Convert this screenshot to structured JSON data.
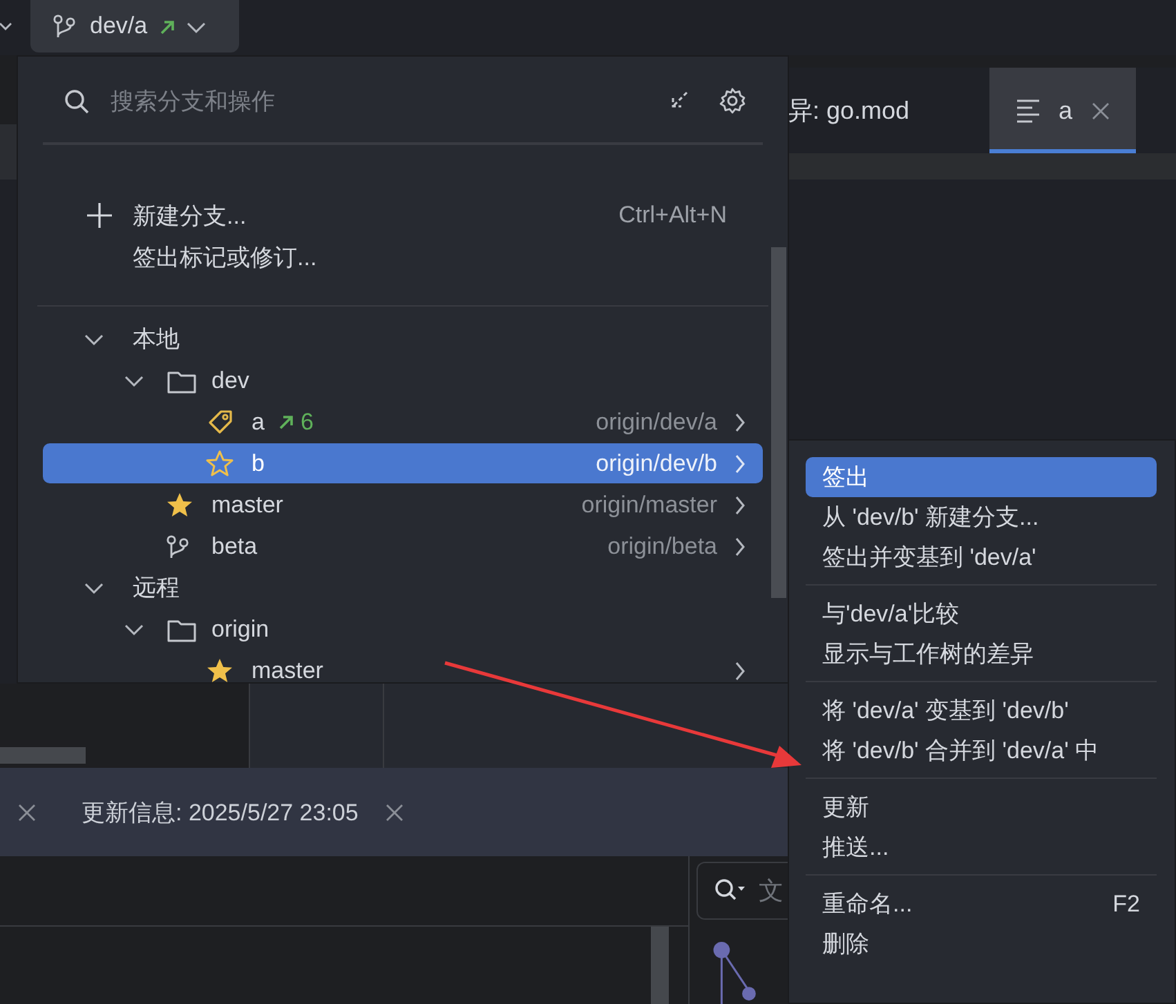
{
  "branch_button": {
    "label": "dev/a",
    "outgoing": true
  },
  "editor_tabs": [
    {
      "label": "异: go.mod",
      "selected": false,
      "closable": false
    },
    {
      "label": "a",
      "selected": true,
      "closable": true
    }
  ],
  "branch_popup": {
    "search": {
      "placeholder": "搜索分支和操作"
    },
    "actions": [
      {
        "label": "新建分支...",
        "shortcut": "Ctrl+Alt+N",
        "kind": "add"
      },
      {
        "label": "签出标记或修订...",
        "kind": "plain"
      }
    ],
    "tree": [
      {
        "label": "本地",
        "expanded": true,
        "children": [
          {
            "label": "dev",
            "kind": "folder",
            "expanded": true,
            "children": [
              {
                "label": "a",
                "kind": "current",
                "outgoing": "6",
                "tracking": "origin/dev/a",
                "selected": false
              },
              {
                "label": "b",
                "kind": "unstarred",
                "tracking": "origin/dev/b",
                "selected": true
              }
            ]
          },
          {
            "label": "master",
            "kind": "starred",
            "tracking": "origin/master",
            "selected": false
          },
          {
            "label": "beta",
            "kind": "branch",
            "tracking": "origin/beta",
            "selected": false
          }
        ]
      },
      {
        "label": "远程",
        "expanded": true,
        "children": [
          {
            "label": "origin",
            "kind": "folder",
            "expanded": true,
            "children": [
              {
                "label": "master",
                "kind": "starred",
                "selected": false
              }
            ]
          }
        ]
      }
    ]
  },
  "context_menu": {
    "groups": [
      [
        {
          "label": "签出",
          "selected": true
        },
        {
          "label": "从 'dev/b' 新建分支...",
          "selected": false
        },
        {
          "label": "签出并变基到 'dev/a'",
          "selected": false
        }
      ],
      [
        {
          "label": "与'dev/a'比较",
          "selected": false
        },
        {
          "label": "显示与工作树的差异",
          "selected": false
        }
      ],
      [
        {
          "label": "将 'dev/a' 变基到 'dev/b'",
          "selected": false
        },
        {
          "label": "将 'dev/b' 合并到 'dev/a' 中",
          "selected": false
        }
      ],
      [
        {
          "label": "更新",
          "selected": false
        },
        {
          "label": "推送...",
          "selected": false
        }
      ],
      [
        {
          "label": "重命名...",
          "shortcut": "F2",
          "selected": false
        },
        {
          "label": "删除",
          "selected": false
        }
      ]
    ]
  },
  "tool_tabs": [
    {
      "label": "更新信息: 2025/5/27 23:05",
      "closable": true
    }
  ],
  "log_search": {
    "placeholder": "文"
  }
}
